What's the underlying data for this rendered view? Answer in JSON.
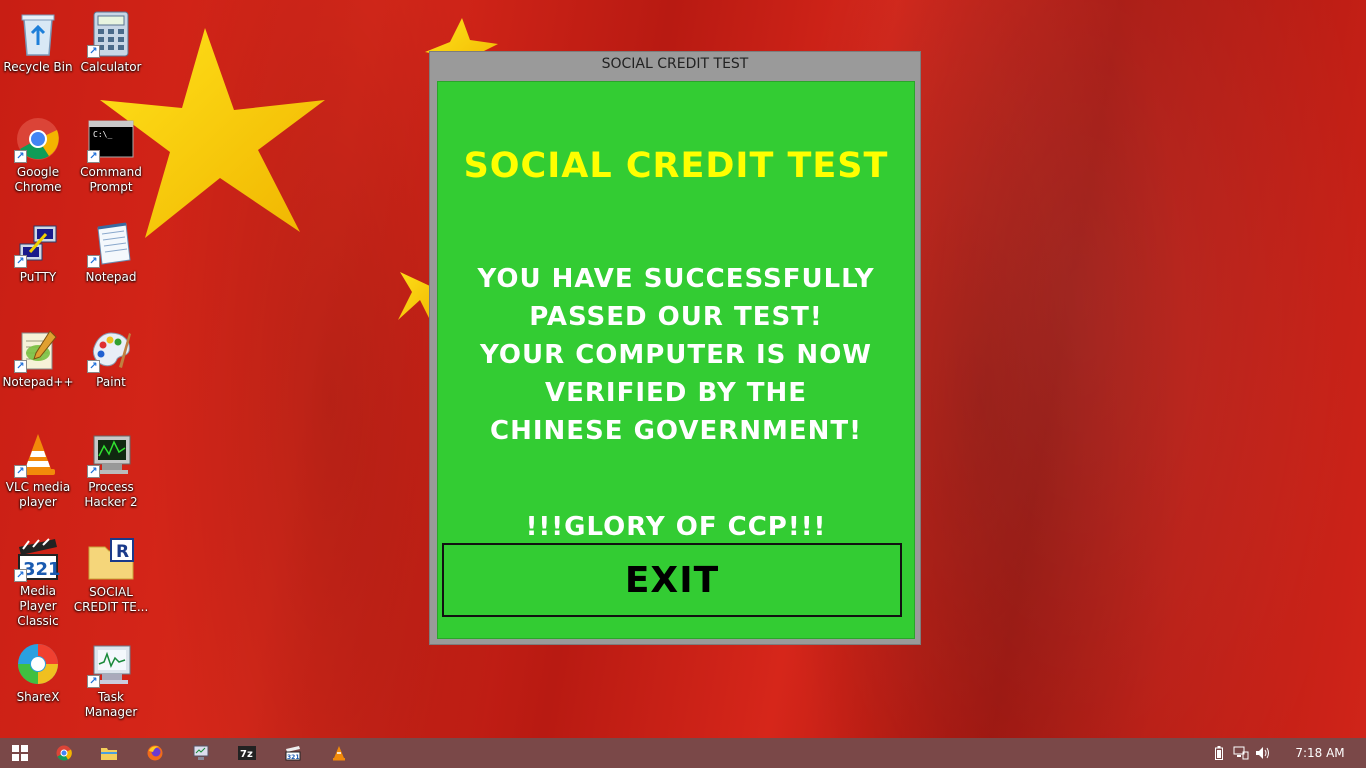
{
  "desktop": {
    "icons": [
      {
        "label": "Recycle Bin",
        "icon": "recycle-bin-icon"
      },
      {
        "label": "Calculator",
        "icon": "calculator-icon"
      },
      {
        "label": "Google Chrome",
        "icon": "chrome-icon"
      },
      {
        "label": "Command Prompt",
        "icon": "command-prompt-icon"
      },
      {
        "label": "PuTTY",
        "icon": "putty-icon"
      },
      {
        "label": "Notepad",
        "icon": "notepad-icon"
      },
      {
        "label": "Notepad++",
        "icon": "notepad-plus-plus-icon"
      },
      {
        "label": "Paint",
        "icon": "paint-icon"
      },
      {
        "label": "VLC media player",
        "icon": "vlc-icon"
      },
      {
        "label": "Process Hacker 2",
        "icon": "process-hacker-icon"
      },
      {
        "label": "Media Player Classic",
        "icon": "media-player-classic-icon"
      },
      {
        "label": "SOCIAL CREDIT TE...",
        "icon": "social-credit-folder-icon"
      },
      {
        "label": "ShareX",
        "icon": "sharex-icon"
      },
      {
        "label": "Task Manager",
        "icon": "task-manager-icon"
      }
    ]
  },
  "dialog": {
    "window_title": "SOCIAL CREDIT TEST",
    "heading": "SOCIAL CREDIT TEST",
    "message_lines": [
      "YOU HAVE SUCCESSFULLY",
      "PASSED OUR TEST!",
      "YOUR COMPUTER IS NOW",
      "VERIFIED BY THE",
      "CHINESE GOVERNMENT!"
    ],
    "glory": "!!!GLORY OF CCP!!!",
    "exit_label": "EXIT",
    "colors": {
      "body": "#33cc33",
      "heading": "#ffff00",
      "text": "#ffffff",
      "frame": "#9a9a9a"
    }
  },
  "taskbar": {
    "buttons": [
      "windows-start-icon",
      "chrome-icon",
      "file-explorer-icon",
      "firefox-icon",
      "monitor-app-icon",
      "7zip-icon",
      "media-player-classic-icon",
      "vlc-icon"
    ],
    "tray": [
      "battery-icon",
      "network-icon",
      "volume-icon"
    ],
    "clock": "7:18 AM"
  }
}
